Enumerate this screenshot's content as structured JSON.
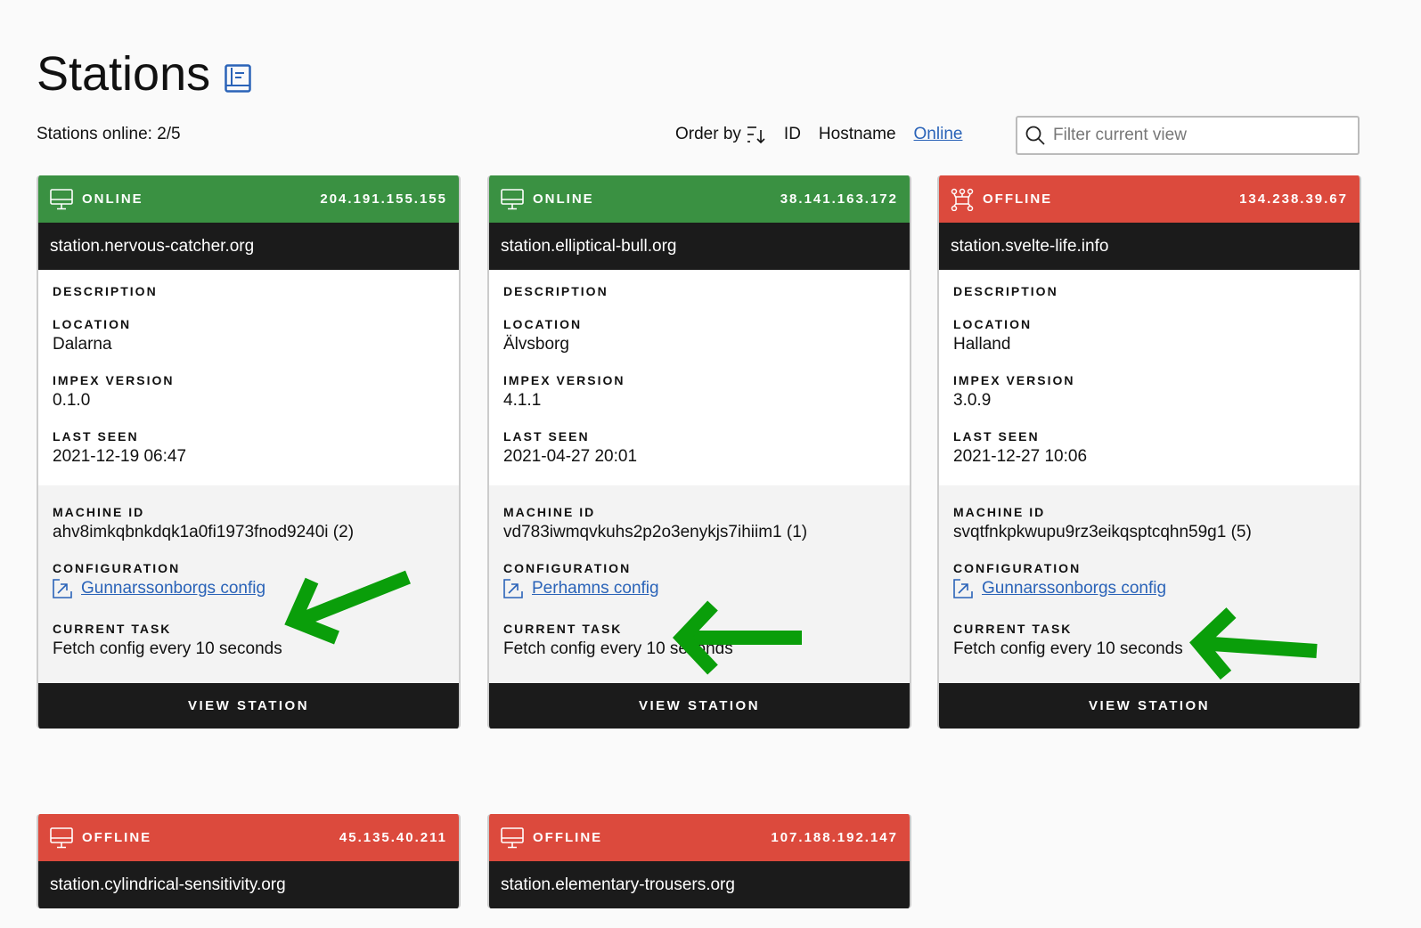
{
  "page": {
    "title": "Stations",
    "online_label": "Stations online: 2/5"
  },
  "toolbar": {
    "order_by": "Order by",
    "options": [
      "ID",
      "Hostname",
      "Online"
    ],
    "active_option": "Online",
    "filter_placeholder": "Filter current view",
    "filter_value": ""
  },
  "labels": {
    "description": "DESCRIPTION",
    "location": "LOCATION",
    "impex": "IMPEX VERSION",
    "last_seen": "LAST SEEN",
    "machine_id": "MACHINE ID",
    "configuration": "CONFIGURATION",
    "current_task": "CURRENT TASK",
    "view": "VIEW STATION"
  },
  "colors": {
    "online": "#3a9142",
    "offline": "#dc4a3d",
    "link": "#2a63b8",
    "annotation_arrow": "#0a9e0a"
  },
  "stations": [
    {
      "status": "ONLINE",
      "icon": "monitor-icon",
      "ip": "204.191.155.155",
      "hostname": "station.nervous-catcher.org",
      "description": "",
      "location": "Dalarna",
      "impex": "0.1.0",
      "last_seen": "2021-12-19 06:47",
      "machine_id": "ahv8imkqbnkdqk1a0fi1973fnod9240i (2)",
      "config": "Gunnarssonborgs config",
      "task": "Fetch config every 10 seconds"
    },
    {
      "status": "ONLINE",
      "icon": "monitor-icon",
      "ip": "38.141.163.172",
      "hostname": "station.elliptical-bull.org",
      "description": "",
      "location": "Älvsborg",
      "impex": "4.1.1",
      "last_seen": "2021-04-27 20:01",
      "machine_id": "vd783iwmqvkuhs2p2o3enykjs7ihiim1 (1)",
      "config": "Perhamns config",
      "task": "Fetch config every 10 seconds"
    },
    {
      "status": "OFFLINE",
      "icon": "network-icon",
      "ip": "134.238.39.67",
      "hostname": "station.svelte-life.info",
      "description": "",
      "location": "Halland",
      "impex": "3.0.9",
      "last_seen": "2021-12-27 10:06",
      "machine_id": "svqtfnkpkwupu9rz3eikqsptcqhn59g1 (5)",
      "config": "Gunnarssonborgs config",
      "task": "Fetch config every 10 seconds"
    },
    {
      "status": "OFFLINE",
      "icon": "monitor-icon",
      "ip": "45.135.40.211",
      "hostname": "station.cylindrical-sensitivity.org"
    },
    {
      "status": "OFFLINE",
      "icon": "monitor-icon",
      "ip": "107.188.192.147",
      "hostname": "station.elementary-trousers.org"
    }
  ]
}
